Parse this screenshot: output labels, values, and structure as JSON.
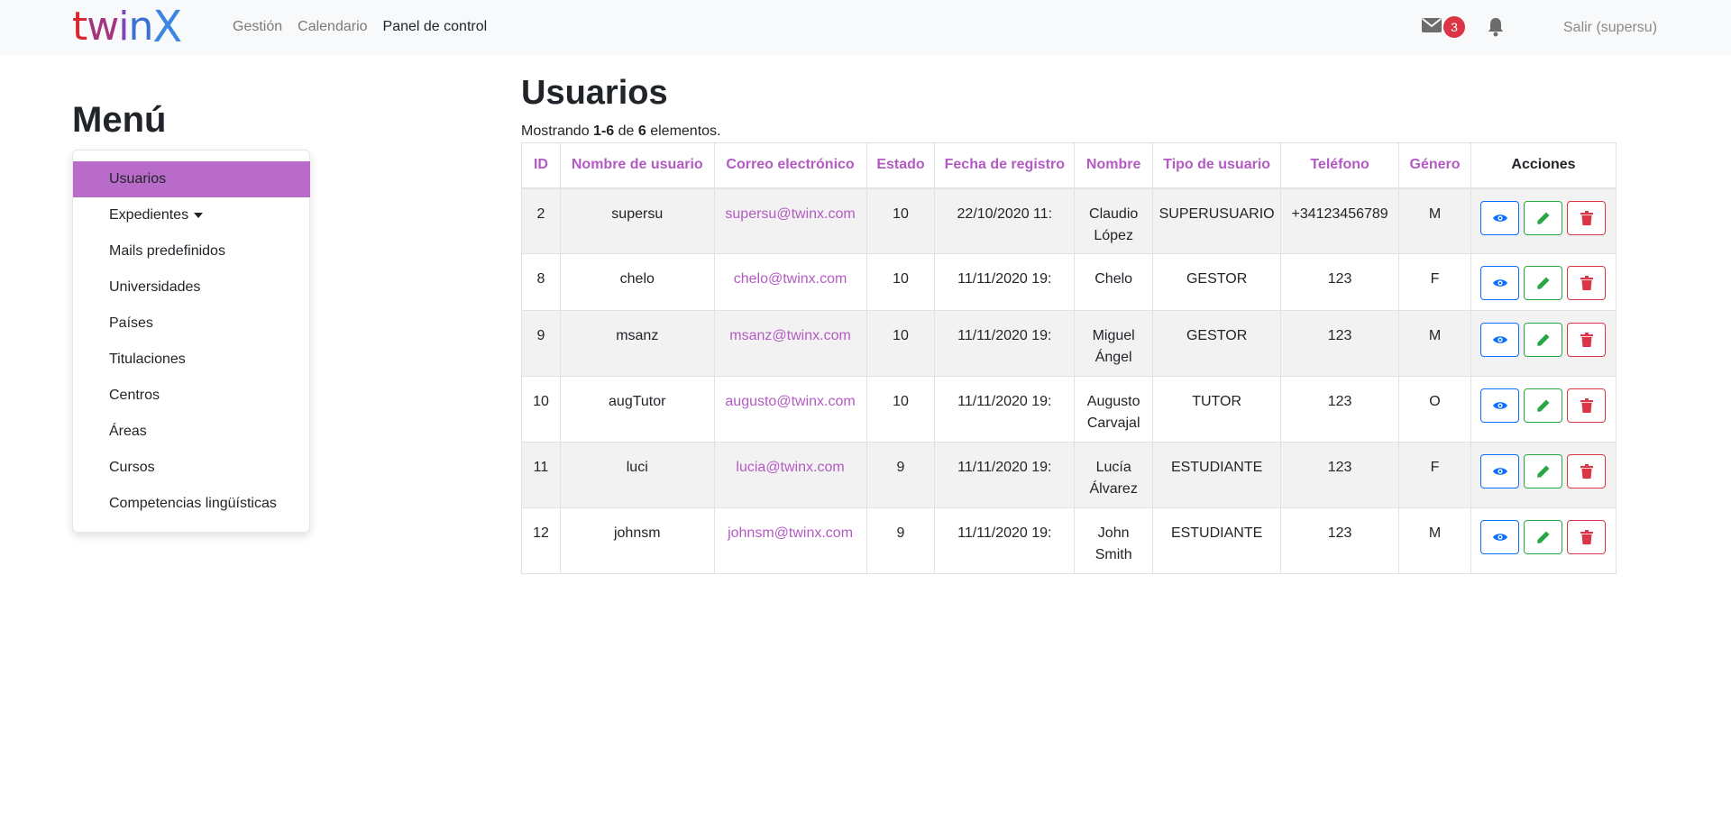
{
  "brand": {
    "letters": [
      "t",
      "w",
      "i",
      "n",
      "X"
    ]
  },
  "nav": {
    "links": [
      "Gestión",
      "Calendario",
      "Panel de control"
    ],
    "mail_count": "3",
    "logout": "Salir (supersu)"
  },
  "sidebar": {
    "title": "Menú",
    "items": [
      {
        "label": "Usuarios"
      },
      {
        "label": "Expedientes"
      },
      {
        "label": "Mails predefinidos"
      },
      {
        "label": "Universidades"
      },
      {
        "label": "Países"
      },
      {
        "label": "Titulaciones"
      },
      {
        "label": "Centros"
      },
      {
        "label": "Áreas"
      },
      {
        "label": "Cursos"
      },
      {
        "label": "Competencias lingüísticas"
      }
    ]
  },
  "main": {
    "title": "Usuarios",
    "summary": {
      "prefix": "Mostrando ",
      "range": "1-6",
      "middle": " de ",
      "total": "6",
      "suffix": " elementos."
    },
    "columns": [
      "ID",
      "Nombre de usuario",
      "Correo electrónico",
      "Estado",
      "Fecha de registro",
      "Nombre",
      "Tipo de usuario",
      "Teléfono",
      "Género",
      "Acciones"
    ],
    "rows": [
      {
        "id": "2",
        "username": "supersu",
        "email": "supersu@twinx.com",
        "estado": "10",
        "fecha": "22/10/2020 11:",
        "nombre1": "Claudio",
        "nombre2": "López",
        "tipo": "SUPERUSUARIO",
        "telefono": "+34123456789",
        "genero": "M"
      },
      {
        "id": "8",
        "username": "chelo",
        "email": "chelo@twinx.com",
        "estado": "10",
        "fecha": "11/11/2020 19:",
        "nombre1": "Chelo",
        "nombre2": "",
        "tipo": "GESTOR",
        "telefono": "123",
        "genero": "F"
      },
      {
        "id": "9",
        "username": "msanz",
        "email": "msanz@twinx.com",
        "estado": "10",
        "fecha": "11/11/2020 19:",
        "nombre1": "Miguel",
        "nombre2": "Ángel",
        "tipo": "GESTOR",
        "telefono": "123",
        "genero": "M"
      },
      {
        "id": "10",
        "username": "augTutor",
        "email": "augusto@twinx.com",
        "estado": "10",
        "fecha": "11/11/2020 19:",
        "nombre1": "Augusto",
        "nombre2": "Carvajal",
        "tipo": "TUTOR",
        "telefono": "123",
        "genero": "O"
      },
      {
        "id": "11",
        "username": "luci",
        "email": "lucia@twinx.com",
        "estado": "9",
        "fecha": "11/11/2020 19:",
        "nombre1": "Lucía",
        "nombre2": "Álvarez",
        "tipo": "ESTUDIANTE",
        "telefono": "123",
        "genero": "F"
      },
      {
        "id": "12",
        "username": "johnsm",
        "email": "johnsm@twinx.com",
        "estado": "9",
        "fecha": "11/11/2020 19:",
        "nombre1": "John",
        "nombre2": "Smith",
        "tipo": "ESTUDIANTE",
        "telefono": "123",
        "genero": "M"
      }
    ],
    "action_icons": [
      "eye-icon",
      "pencil-icon",
      "trash-icon"
    ]
  },
  "colors": {
    "accent": "#b35bc3",
    "active_menu": "#b86bc8",
    "view": "#0d6efd",
    "edit": "#28a745",
    "delete": "#dc3545",
    "badge": "#dc3545"
  }
}
